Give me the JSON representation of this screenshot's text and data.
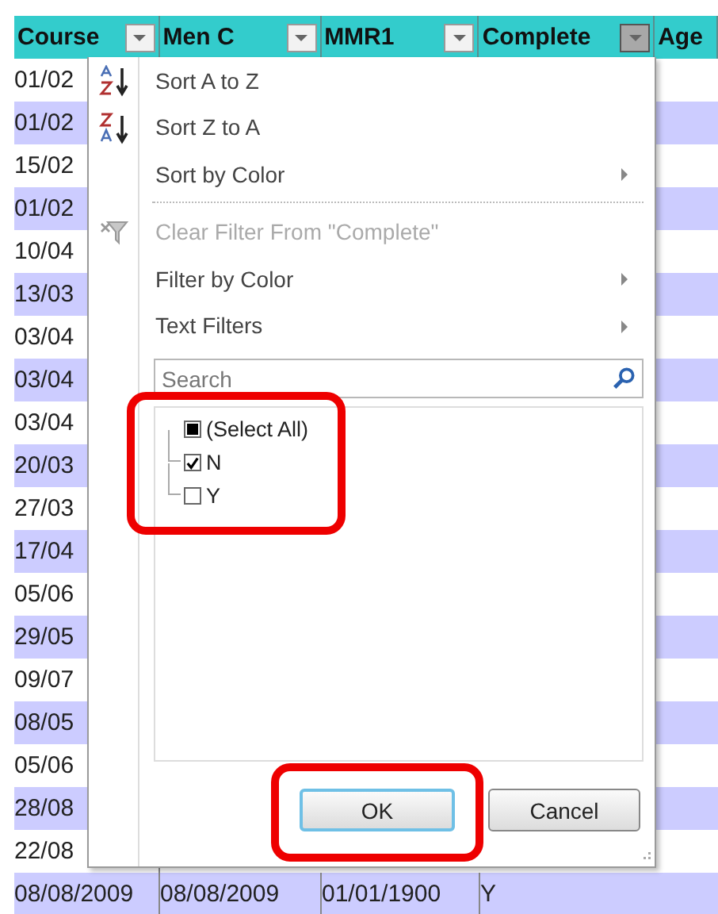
{
  "columns": [
    {
      "label": "Course",
      "filter_active": false
    },
    {
      "label": "Men C",
      "filter_active": false
    },
    {
      "label": "MMR1",
      "filter_active": false
    },
    {
      "label": "Complete",
      "filter_active": true
    },
    {
      "label": "Age"
    }
  ],
  "rows": [
    {
      "cells": [
        "01/02"
      ],
      "shaded": false
    },
    {
      "cells": [
        "01/02"
      ],
      "shaded": true
    },
    {
      "cells": [
        "15/02"
      ],
      "shaded": false
    },
    {
      "cells": [
        "01/02"
      ],
      "shaded": true
    },
    {
      "cells": [
        "10/04"
      ],
      "shaded": false
    },
    {
      "cells": [
        "13/03"
      ],
      "shaded": true
    },
    {
      "cells": [
        "03/04"
      ],
      "shaded": false
    },
    {
      "cells": [
        "03/04"
      ],
      "shaded": true
    },
    {
      "cells": [
        "03/04"
      ],
      "shaded": false
    },
    {
      "cells": [
        "20/03"
      ],
      "shaded": true
    },
    {
      "cells": [
        "27/03"
      ],
      "shaded": false
    },
    {
      "cells": [
        "17/04"
      ],
      "shaded": true
    },
    {
      "cells": [
        "05/06"
      ],
      "shaded": false
    },
    {
      "cells": [
        "29/05"
      ],
      "shaded": true
    },
    {
      "cells": [
        "09/07"
      ],
      "shaded": false
    },
    {
      "cells": [
        "08/05"
      ],
      "shaded": true
    },
    {
      "cells": [
        "05/06"
      ],
      "shaded": false
    },
    {
      "cells": [
        "28/08"
      ],
      "shaded": true
    },
    {
      "cells": [
        "22/08"
      ],
      "shaded": false
    },
    {
      "cells": [
        "08/08/2009",
        "08/08/2009",
        "01/01/1900",
        "Y"
      ],
      "shaded": true
    }
  ],
  "filter_menu": {
    "items": [
      {
        "kind": "sort-asc",
        "label": "Sort A to Z",
        "disabled": false,
        "submenu": false
      },
      {
        "kind": "sort-desc",
        "label": "Sort Z to A",
        "disabled": false,
        "submenu": false
      },
      {
        "kind": "plain",
        "label": "Sort by Color",
        "disabled": false,
        "submenu": true
      },
      {
        "kind": "clear-filter",
        "label": "Clear Filter From \"Complete\"",
        "disabled": true,
        "submenu": false
      },
      {
        "kind": "plain",
        "label": "Filter by Color",
        "disabled": false,
        "submenu": true
      },
      {
        "kind": "plain",
        "label": "Text Filters",
        "disabled": false,
        "submenu": true
      }
    ],
    "search": {
      "placeholder": "Search"
    },
    "values": [
      {
        "label": "(Select All)",
        "mixed": true
      },
      {
        "label": "N",
        "checked": true
      },
      {
        "label": "Y",
        "checked": false
      }
    ],
    "buttons": [
      {
        "label": "OK",
        "default": true
      },
      {
        "label": "Cancel",
        "default": false
      }
    ]
  }
}
